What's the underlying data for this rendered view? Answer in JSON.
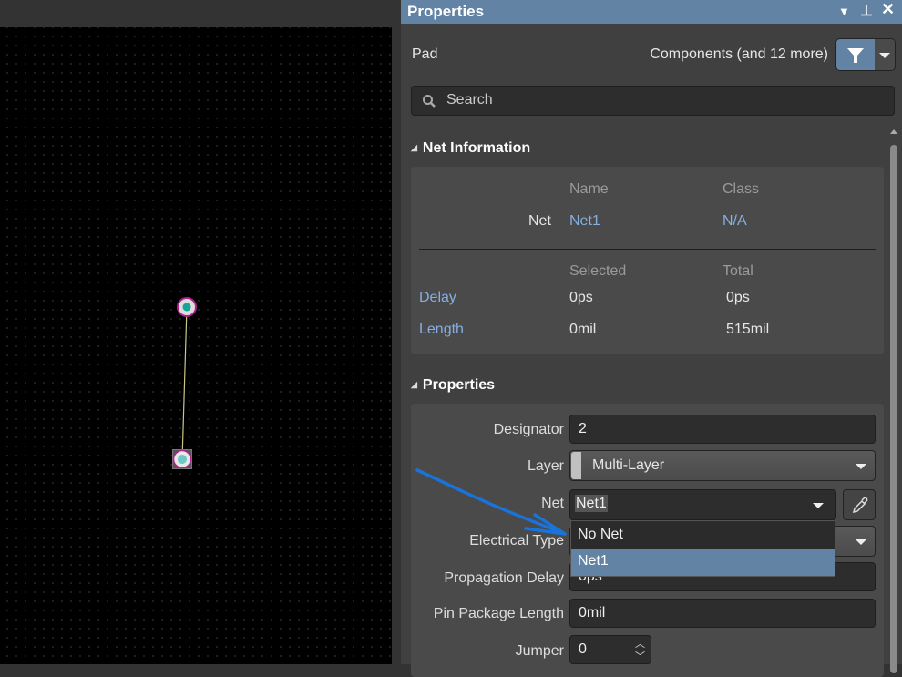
{
  "panel": {
    "title": "Properties",
    "object_type": "Pad",
    "filter_text": "Components (and 12 more)",
    "search_placeholder": "Search"
  },
  "net_information": {
    "header": "Net Information",
    "col_name": "Name",
    "col_class": "Class",
    "net_label": "Net",
    "net_name": "Net1",
    "net_class": "N/A",
    "col_selected": "Selected",
    "col_total": "Total",
    "delay_label": "Delay",
    "delay_selected": "0ps",
    "delay_total": "0ps",
    "length_label": "Length",
    "length_selected": "0mil",
    "length_total": "515mil"
  },
  "properties": {
    "header": "Properties",
    "designator_label": "Designator",
    "designator_value": "2",
    "layer_label": "Layer",
    "layer_value": "Multi-Layer",
    "net_label": "Net",
    "net_value": "Net1",
    "electrical_type_label": "Electrical Type",
    "propagation_delay_label": "Propagation Delay",
    "propagation_delay_value": "0ps",
    "pin_package_length_label": "Pin Package Length",
    "pin_package_length_value": "0mil",
    "jumper_label": "Jumper",
    "jumper_value": "0"
  },
  "net_dropdown": {
    "options": [
      "No Net",
      "Net1"
    ],
    "highlighted": "Net1"
  },
  "colors": {
    "accent": "#6283a4",
    "link": "#86aee0",
    "annotation_arrow": "#1a73d9",
    "pad_ring": "#b0208f",
    "pad_hole": "#16a39a"
  }
}
